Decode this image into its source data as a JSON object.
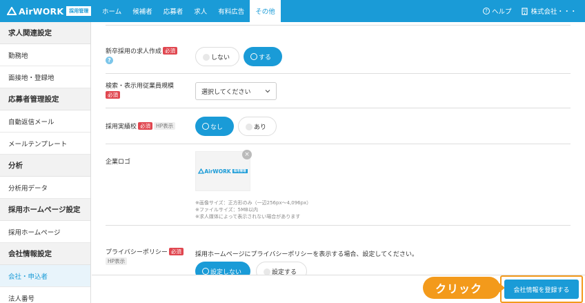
{
  "header": {
    "logo_text": "AirWORK",
    "logo_badge": "採用管理",
    "nav": [
      "ホーム",
      "候補者",
      "応募者",
      "求人",
      "有料広告",
      "その他"
    ],
    "active_nav": "その他",
    "help_label": "ヘルプ",
    "company_label": "株式会社・・・"
  },
  "sidebar": {
    "sections": [
      {
        "title": "求人関連設定",
        "items": [
          "勤務地",
          "面接地・登録地"
        ]
      },
      {
        "title": "応募者管理設定",
        "items": [
          "自動返信メール",
          "メールテンプレート"
        ]
      },
      {
        "title": "分析",
        "items": [
          "分析用データ"
        ]
      },
      {
        "title": "採用ホームページ設定",
        "items": [
          "採用ホームページ"
        ]
      },
      {
        "title": "会社情報設定",
        "items": [
          "会社・申込者",
          "法人番号"
        ]
      }
    ],
    "active_item": "会社・申込者"
  },
  "form": {
    "required": "必須",
    "hp_tag": "HP表示",
    "newgrad": {
      "label": "新卒採用の求人作成",
      "off": "しない",
      "on": "する",
      "selected": "する"
    },
    "employees": {
      "label": "検索・表示用従業員規模",
      "placeholder": "選択してください"
    },
    "record": {
      "label": "採用実績校",
      "on": "なし",
      "off": "あり",
      "selected": "なし"
    },
    "logo": {
      "label": "企業ロゴ",
      "logo_text": "AirWORK",
      "logo_badge": "採用管理",
      "notes": [
        "※画像サイズ：正方形のみ（一辺256px〜4,096px）",
        "※ファイルサイズ：5MB以内",
        "※求人媒体によって表示されない場合があります"
      ]
    },
    "privacy": {
      "label": "プライバシーポリシー",
      "description": "採用ホームページにプライバシーポリシーを表示する場合、設定してください。",
      "on": "設定しない",
      "off": "設定する",
      "selected": "設定しない"
    }
  },
  "footer": {
    "callout": "クリック",
    "submit_label": "会社情報を登録する"
  },
  "colors": {
    "brand": "#1a9bd7",
    "required": "#e0464f",
    "callout": "#f39a1b"
  }
}
